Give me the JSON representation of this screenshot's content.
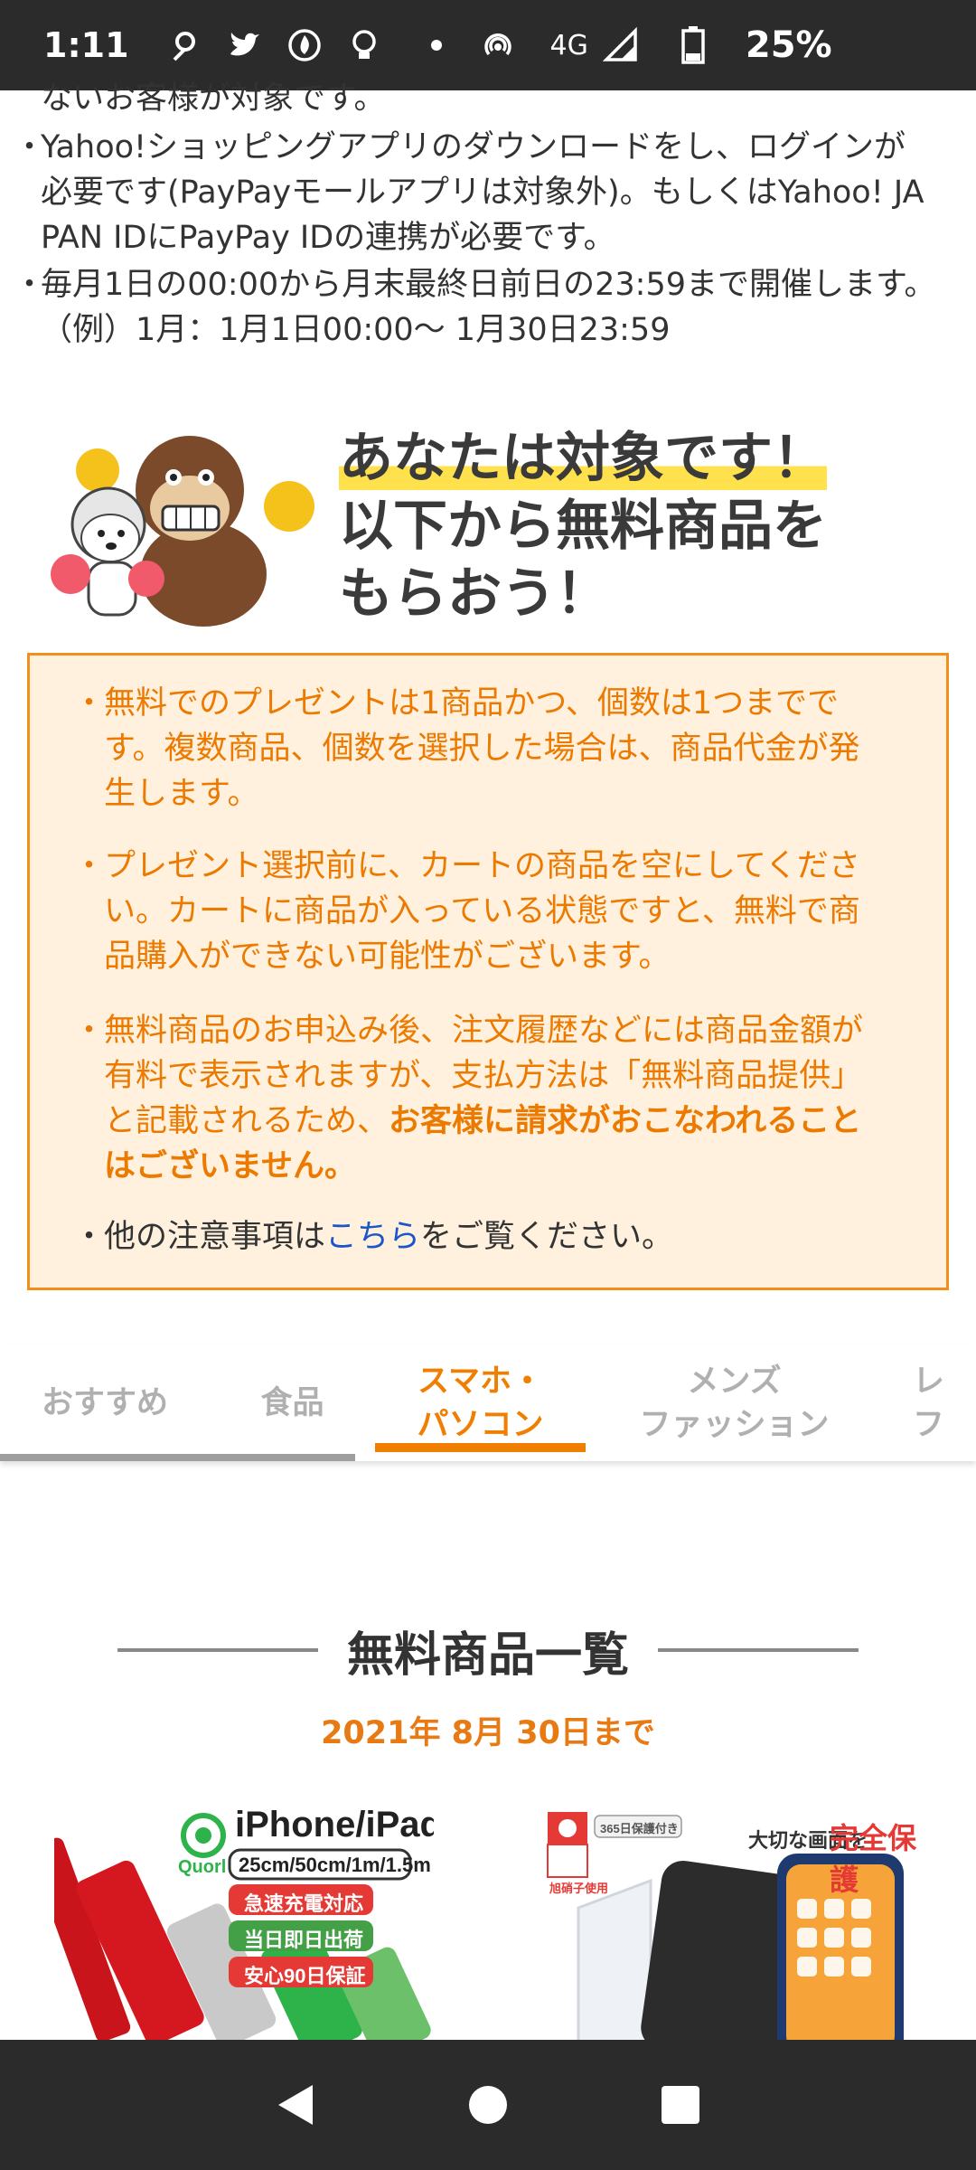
{
  "status_bar": {
    "time": "1:11",
    "network": "4G",
    "battery": "25%",
    "icons": [
      "location-icon",
      "twitter-icon",
      "fire-icon",
      "bulb-icon",
      "hotspot-icon",
      "signal-icon",
      "battery-icon"
    ]
  },
  "notes": {
    "line0": "ないお客様が対象です。",
    "line1": "Yahoo!ショッピングアプリのダウンロードをし、ログインが",
    "line2": "必要です(PayPayモールアプリは対象外)。もしくはYahoo! JA",
    "line3": "PAN IDにPayPay IDの連携が必要です。",
    "line4": "毎月1日の00:00から月末最終日前日の23:59まで開催します。",
    "line5": "（例）1月：1月1日00:00〜 1月30日23:59"
  },
  "hero": {
    "line1": "あなたは対象です！",
    "line2": "以下から無料商品を",
    "line3": "もらおう！"
  },
  "notice": {
    "item1": {
      "l1": "無料でのプレゼントは1商品かつ、個数は1つまでで",
      "l2": "す。複数商品、個数を選択した場合は、商品代金が発",
      "l3": "生します。"
    },
    "item2": {
      "l1": "プレゼント選択前に、カートの商品を空にしてくださ",
      "l2": "い。カートに商品が入っている状態ですと、無料で商",
      "l3": "品購入ができない可能性がございます。"
    },
    "item3": {
      "l1": "無料商品のお申込み後、注文履歴などには商品金額が",
      "l2": "有料で表示されますが、支払方法は「無料商品提供」",
      "l3a": "と記載されるため、",
      "l3b": "お客様に請求がおこなわれること",
      "l4": "はございません。"
    },
    "item4": {
      "before": "他の注意事項は",
      "link": "こちら",
      "after": "をご覧ください。"
    }
  },
  "tabs": [
    {
      "label": "おすすめ"
    },
    {
      "label": "食品"
    },
    {
      "label1": "スマホ・",
      "label2": "パソコン",
      "active": true
    },
    {
      "label1": "メンズ",
      "label2": "ファッション"
    },
    {
      "label1": "レ",
      "label2": "フ"
    }
  ],
  "section": {
    "title": "無料商品一覧",
    "deadline": "2021年 8月 30日まで"
  },
  "products": [
    {
      "brand": "Quorl",
      "title": "iPhone/iPad",
      "sizes": "25cm/50cm/1m/1.5m",
      "badges": [
        "急速充電対応",
        "当日即日出荷",
        "安心90日保証"
      ]
    },
    {
      "badge": "365日保護付き",
      "caption": "大切な画面を",
      "highlight": "完全保護",
      "corner": "旭硝子使用"
    }
  ],
  "colors": {
    "accent": "#f07e00",
    "notice_bg": "#fff1de",
    "link": "#1a56c8",
    "highlight": "#ffe14d"
  }
}
